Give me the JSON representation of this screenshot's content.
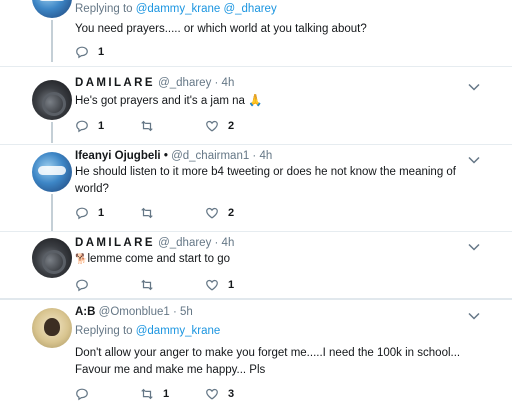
{
  "tweets": [
    {
      "reply_prefix": "Replying to ",
      "reply_users": "@dammy_krane @_dharey",
      "text": "You need prayers..... or which world at you talking about?",
      "reply_count": "1",
      "retweet_count": "",
      "like_count": ""
    },
    {
      "name": "DAMILARE",
      "handle": "@_dharey · 4h",
      "text": "He's got prayers and it's a jam na",
      "emoji": "🙏",
      "reply_count": "1",
      "retweet_count": "",
      "like_count": "2"
    },
    {
      "name": "Ifeanyi Ojugbeli",
      "verified_mark": "•",
      "handle": "@d_chairman1 · 4h",
      "text": "He should listen to it more b4 tweeting or does he not know the meaning of world?",
      "reply_count": "1",
      "retweet_count": "",
      "like_count": "2"
    },
    {
      "name": "DAMILARE",
      "handle": "@_dharey · 4h",
      "emoji": "🐕",
      "text": "lemme come and start to go",
      "reply_count": "",
      "retweet_count": "",
      "like_count": "1"
    },
    {
      "name": "A:B",
      "handle": "@Omonblue1 · 5h",
      "reply_prefix": "Replying to ",
      "reply_users": "@dammy_krane",
      "text": "Don't allow your anger to make you forget me.....I need the 100k in school... Favour me and make me happy... Pls",
      "reply_count": "",
      "retweet_count": "1",
      "like_count": "3"
    }
  ],
  "colors": {
    "link": "#1b95e0",
    "secondary": "#657786",
    "thread_line": "#c4cfd6",
    "divider": "#e6ecf0"
  }
}
